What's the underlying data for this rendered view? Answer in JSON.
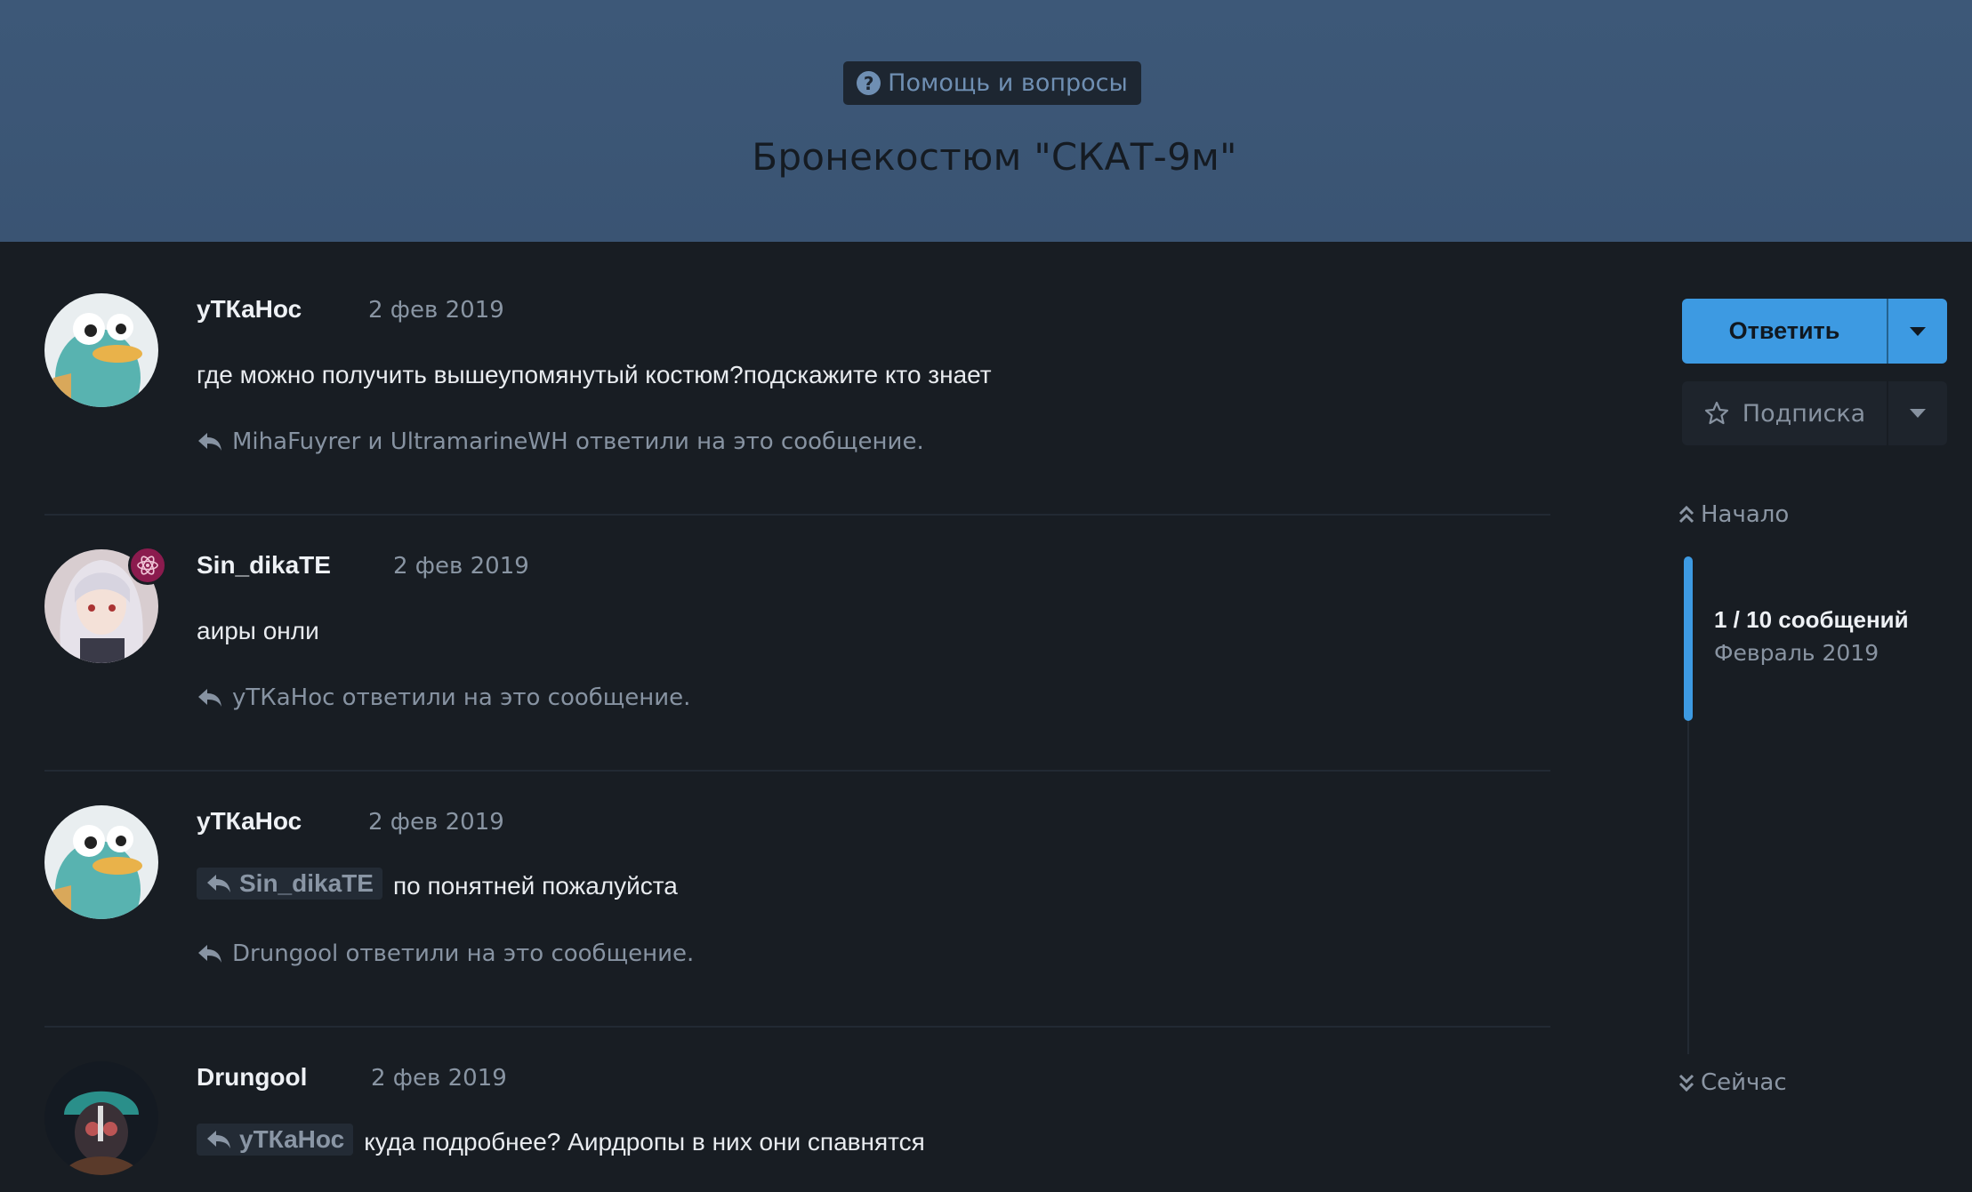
{
  "category": {
    "label": "Помощь и вопросы",
    "icon": "question-circle-icon",
    "color": "#6f8fb3"
  },
  "topic": {
    "title": "Бронекостюм \"СКАТ-9м\""
  },
  "posts": [
    {
      "author": "уТКаНос",
      "date": "2 фев 2019",
      "text": "где можно получить вышеупомянутый костюм?подскажите кто знает",
      "replied": "MihaFuyrer и UltramarineWH ответили на это сообщение."
    },
    {
      "author": "Sin_dikaTE",
      "date": "2 фев 2019",
      "text": "аиры онли",
      "replied": "уТКаНос ответили на это сообщение."
    },
    {
      "author": "уТКаНос",
      "date": "2 фев 2019",
      "mention": "Sin_dikaTE",
      "text": "по понятней пожалуйста",
      "replied": "Drungool ответили на это сообщение."
    },
    {
      "author": "Drungool",
      "date": "2 фев 2019",
      "mention": "уТКаНос",
      "text": "куда подробнее? Аирдропы в них они спавнятся"
    }
  ],
  "sidebar": {
    "reply_label": "Ответить",
    "follow_label": "Подписка",
    "start_label": "Начало",
    "now_label": "Сейчас",
    "timeline_count": "1 / 10 сообщений",
    "timeline_date": "Февраль 2019",
    "accent": "#3d9ae2"
  }
}
